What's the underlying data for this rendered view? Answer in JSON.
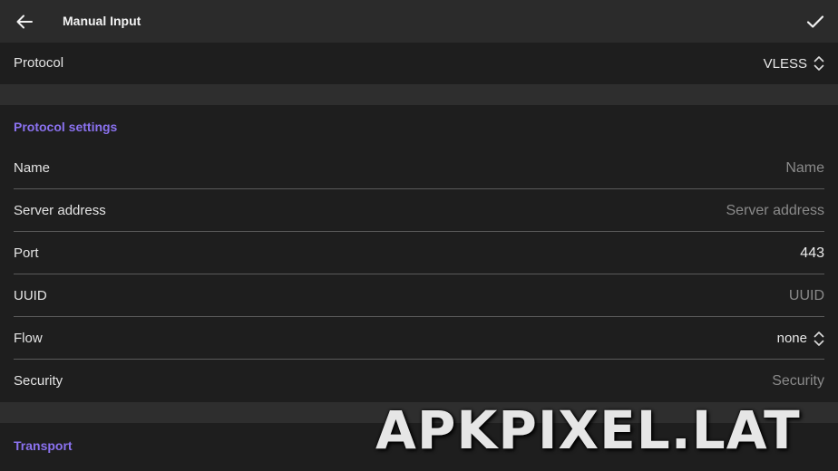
{
  "header": {
    "title": "Manual Input",
    "back_icon": "arrow-left-icon",
    "confirm_icon": "check-icon"
  },
  "protocol": {
    "label": "Protocol",
    "value": "VLESS",
    "chevron_icon": "unfold-chevron-icon"
  },
  "protocol_settings": {
    "title": "Protocol settings",
    "fields": [
      {
        "label": "Name",
        "value": "",
        "placeholder": "Name"
      },
      {
        "label": "Server address",
        "value": "",
        "placeholder": "Server address"
      },
      {
        "label": "Port",
        "value": "443",
        "placeholder": ""
      },
      {
        "label": "UUID",
        "value": "",
        "placeholder": "UUID"
      }
    ],
    "flow": {
      "label": "Flow",
      "value": "none"
    },
    "security": {
      "label": "Security",
      "value": "",
      "placeholder": "Security"
    }
  },
  "transport": {
    "title": "Transport"
  },
  "watermark": "APKPIXEL.LAT",
  "colors": {
    "accent": "#8b72f0",
    "background": "#262626",
    "surface": "#1e1e1e",
    "divider": "#5a5a5a"
  }
}
